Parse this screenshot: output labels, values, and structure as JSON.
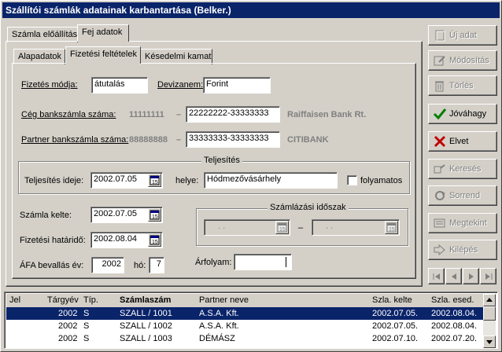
{
  "window": {
    "title": "Szállítói számlák adatainak karbantartása (Belker.)"
  },
  "tabs_top": [
    {
      "label": "Számla előállítás"
    },
    {
      "label": "Fej adatok"
    }
  ],
  "tabs_inner": [
    {
      "label": "Alapadatok"
    },
    {
      "label": "Fizetési feltételek"
    },
    {
      "label": "Késedelmi kamat"
    }
  ],
  "form": {
    "fizetes_modja": {
      "label": "Fizetés módja:",
      "value": "átutalás"
    },
    "devizanem": {
      "label": "Devizanem:",
      "value": "Forint"
    },
    "ceg_bankszamla": {
      "label": "Cég bankszámla száma:",
      "prefix": "11111111",
      "dash": "–",
      "value": "22222222-33333333",
      "bank": "Raiffaisen Bank Rt."
    },
    "partner_bankszamla": {
      "label": "Partner bankszámla száma:",
      "prefix": "88888888",
      "dash": "–",
      "value": "33333333-33333333",
      "bank": "CITIBANK"
    },
    "teljesites": {
      "group_title": "Teljesítés",
      "ideje_label": "Teljesítés ideje:",
      "ideje_value": "2002.07.05",
      "helye_label": "helye:",
      "helye_value": "Hódmezővásárhely",
      "folyamatos_label": "folyamatos",
      "folyamatos_checked": false
    },
    "szamla_kelte": {
      "label": "Számla kelte:",
      "value": "2002.07.05"
    },
    "fizetesi_hatarido": {
      "label": "Fizetési határidő:",
      "value": "2002.08.04"
    },
    "afa": {
      "label": "ÁFA bevallás  év:",
      "ev_value": "2002",
      "ho_label": "hó:",
      "ho_value": "7"
    },
    "szamlazasi_idoszak": {
      "group_title": "Számlázási időszak",
      "from_placeholder": ". .",
      "to_placeholder": ". .",
      "dash": "–"
    },
    "arfolyam": {
      "label": "Árfolyam:",
      "value": ""
    }
  },
  "buttons": [
    {
      "label": "Új adat",
      "enabled": false,
      "icon": "new-icon"
    },
    {
      "label": "Módosítás",
      "enabled": false,
      "icon": "edit-icon"
    },
    {
      "label": "Törlés",
      "enabled": false,
      "icon": "trash-icon"
    },
    {
      "label": "Jóváhagy",
      "enabled": true,
      "icon": "check-icon",
      "color": "#008000"
    },
    {
      "label": "Elvet",
      "enabled": true,
      "icon": "cross-icon",
      "color": "#c00000"
    },
    {
      "label": "Keresés",
      "enabled": false,
      "icon": "search-icon"
    },
    {
      "label": "Sorrend",
      "enabled": false,
      "icon": "sort-icon"
    },
    {
      "label": "Megtekint",
      "enabled": false,
      "icon": "view-icon"
    },
    {
      "label": "Kilépés",
      "enabled": false,
      "icon": "exit-icon"
    }
  ],
  "grid": {
    "columns": [
      "Jel",
      "Tárgyév",
      "Típ.",
      "Számlaszám",
      "Partner neve",
      "Szla. kelte",
      "Szla. esed."
    ],
    "rows": [
      {
        "jel": "",
        "targyev": "2002",
        "tip": "S",
        "szamlaszam": "SZALL / 1001",
        "partner": "A.S.A. Kft.",
        "kelte": "2002.07.05.",
        "esed": "2002.08.04.",
        "selected": true
      },
      {
        "jel": "",
        "targyev": "2002",
        "tip": "S",
        "szamlaszam": "SZALL / 1002",
        "partner": "A.S.A. Kft.",
        "kelte": "2002.07.05.",
        "esed": "2002.08.04.",
        "selected": false
      },
      {
        "jel": "",
        "targyev": "2002",
        "tip": "S",
        "szamlaszam": "SZALL / 1003",
        "partner": "DÉMÁSZ",
        "kelte": "2002.07.10.",
        "esed": "2002.07.20.",
        "selected": false
      }
    ]
  }
}
